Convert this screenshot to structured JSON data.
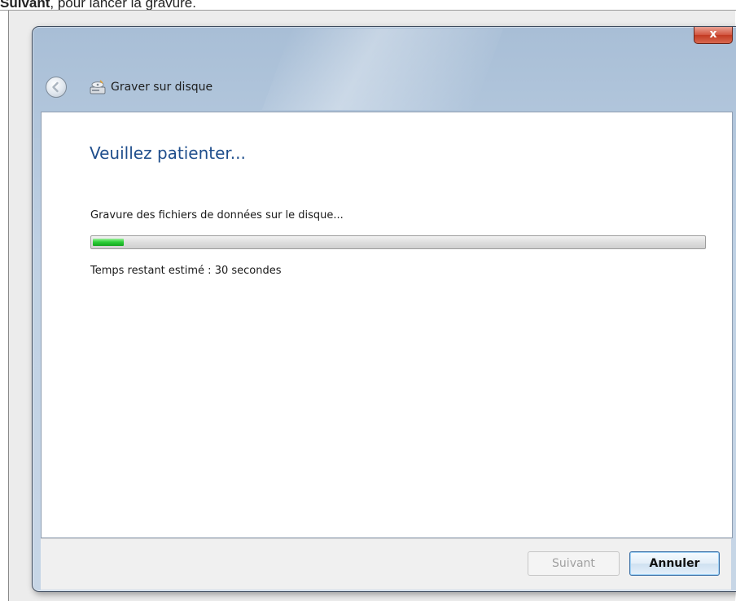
{
  "page": {
    "caption_bold": "Suivant",
    "caption_rest": ", pour lancer la gravure."
  },
  "window": {
    "title": "Graver sur disque",
    "close_label": "x",
    "back_icon": "back-arrow-icon",
    "title_icon": "disc-burner-icon"
  },
  "main": {
    "heading": "Veuillez patienter...",
    "status": "Gravure des fichiers de données sur le disque...",
    "progress_percent": 5,
    "time_remaining": "Temps restant estimé : 30 secondes"
  },
  "footer": {
    "next_label": "Suivant",
    "cancel_label": "Annuler"
  },
  "colors": {
    "heading": "#1f4e8c",
    "progress": "#2fcf3a",
    "close_button": "#c23a22"
  }
}
